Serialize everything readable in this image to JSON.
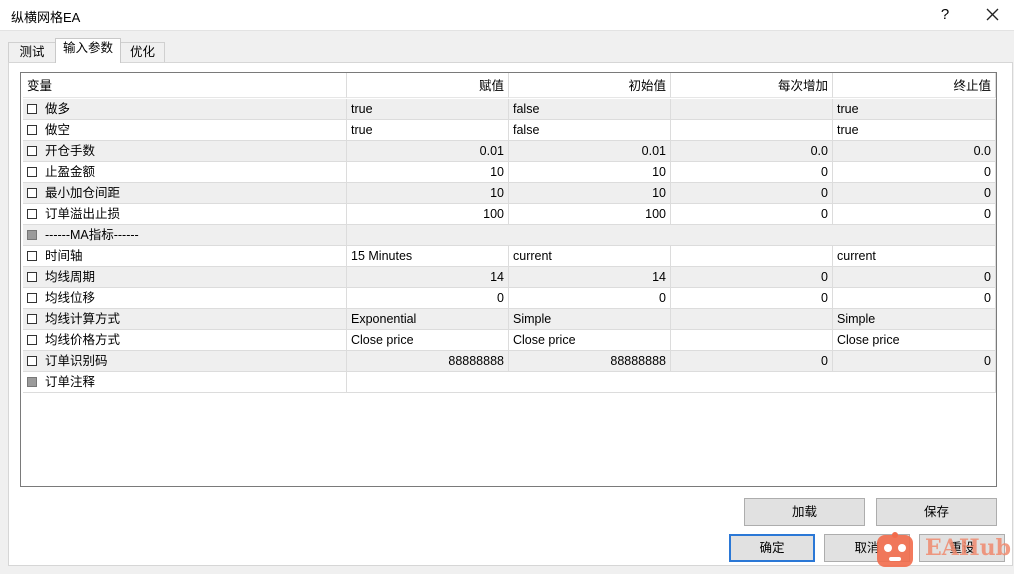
{
  "window": {
    "title": "纵横网格EA",
    "help_label": "?"
  },
  "tabs": [
    {
      "label": "测试",
      "active": false
    },
    {
      "label": "输入参数",
      "active": true
    },
    {
      "label": "优化",
      "active": false
    }
  ],
  "table": {
    "headers": [
      "变量",
      "赋值",
      "初始值",
      "每次增加",
      "终止值"
    ],
    "rows": [
      {
        "name": "做多",
        "value": "true",
        "start": "false",
        "step": "",
        "stop": "true",
        "checked": false,
        "enabled": true
      },
      {
        "name": "做空",
        "value": "true",
        "start": "false",
        "step": "",
        "stop": "true",
        "checked": false,
        "enabled": true
      },
      {
        "name": "开仓手数",
        "value": "0.01",
        "start": "0.01",
        "step": "0.0",
        "stop": "0.0",
        "checked": false,
        "enabled": true
      },
      {
        "name": "止盈金额",
        "value": "10",
        "start": "10",
        "step": "0",
        "stop": "0",
        "checked": false,
        "enabled": true
      },
      {
        "name": "最小加仓间距",
        "value": "10",
        "start": "10",
        "step": "0",
        "stop": "0",
        "checked": false,
        "enabled": true
      },
      {
        "name": "订单溢出止损",
        "value": "100",
        "start": "100",
        "step": "0",
        "stop": "0",
        "checked": false,
        "enabled": true
      },
      {
        "name": "------MA指标------",
        "value": "",
        "start": "",
        "step": "",
        "stop": "",
        "checked": false,
        "enabled": false
      },
      {
        "name": "时间轴",
        "value": "15 Minutes",
        "start": "current",
        "step": "",
        "stop": "current",
        "checked": false,
        "enabled": true
      },
      {
        "name": "均线周期",
        "value": "14",
        "start": "14",
        "step": "0",
        "stop": "0",
        "checked": false,
        "enabled": true
      },
      {
        "name": "均线位移",
        "value": "0",
        "start": "0",
        "step": "0",
        "stop": "0",
        "checked": false,
        "enabled": true
      },
      {
        "name": "均线计算方式",
        "value": "Exponential",
        "start": "Simple",
        "step": "",
        "stop": "Simple",
        "checked": false,
        "enabled": true
      },
      {
        "name": "均线价格方式",
        "value": "Close price",
        "start": "Close price",
        "step": "",
        "stop": "Close price",
        "checked": false,
        "enabled": true
      },
      {
        "name": "订单识别码",
        "value": "88888888",
        "start": "88888888",
        "step": "0",
        "stop": "0",
        "checked": false,
        "enabled": true
      },
      {
        "name": "订单注释",
        "value": "",
        "start": "",
        "step": "",
        "stop": "",
        "checked": false,
        "enabled": false
      }
    ]
  },
  "buttons": {
    "load": "加载",
    "save": "保存",
    "ok": "确定",
    "cancel": "取消",
    "reset": "重设"
  },
  "watermark": {
    "text": "EAHub",
    "colors": {
      "logo": "#f26b4b"
    }
  },
  "colors": {
    "default_button_border": "#2b78d6",
    "alt_row": "#efefef"
  }
}
